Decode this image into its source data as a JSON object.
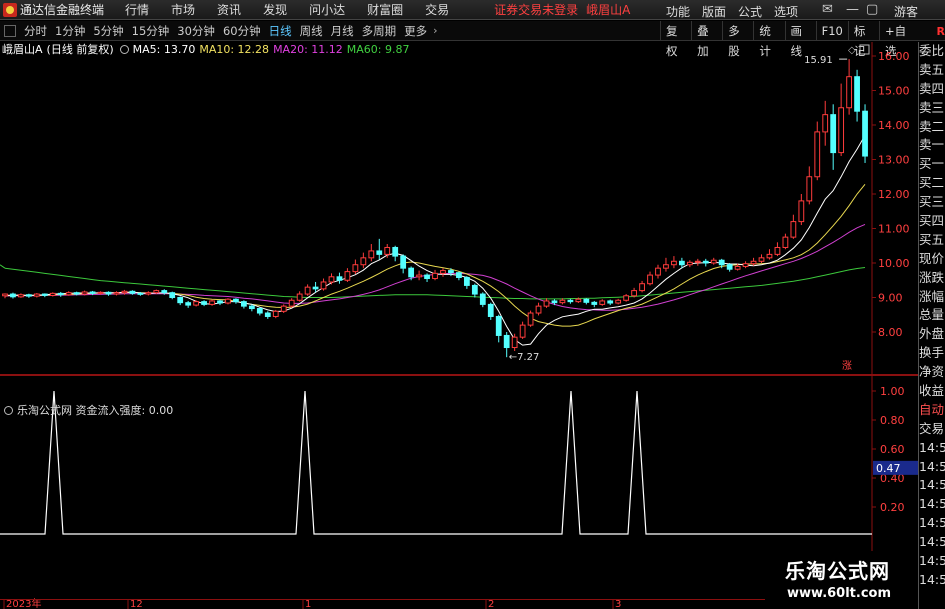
{
  "menubar": {
    "title": "通达信金融终端",
    "items": [
      "行情",
      "市场",
      "资讯",
      "发现",
      "问小达",
      "财富圈",
      "交易"
    ],
    "warning": "证券交易未登录",
    "stock": "峨眉山A",
    "right_items": [
      "功能",
      "版面",
      "公式",
      "选项"
    ],
    "guest": "游客"
  },
  "toolbar": {
    "periods": [
      "分时",
      "1分钟",
      "5分钟",
      "15分钟",
      "30分钟",
      "60分钟",
      "日线",
      "周线",
      "月线",
      "多周期",
      "更多"
    ],
    "active_period": "日线",
    "right_buttons": [
      "复权",
      "叠加",
      "多股",
      "统计",
      "画线",
      "F10",
      "标记",
      "+自选"
    ],
    "r_label": "R"
  },
  "chart_header": {
    "name": "峨眉山A",
    "mode": "(日线 前复权)",
    "ma5": "MA5: 13.70",
    "ma10": "MA10: 12.28",
    "ma20": "MA20: 11.12",
    "ma60": "MA60: 9.87"
  },
  "sub_header": {
    "text": "乐淘公式网 资金流入强度: 0.00"
  },
  "right_panel": {
    "items": [
      "委比",
      "卖五",
      "卖四",
      "卖三",
      "卖二",
      "卖一",
      "买一",
      "买二",
      "买三",
      "买四",
      "买五",
      "现价",
      "涨跌",
      "涨幅",
      "总量",
      "外盘",
      "换手",
      "净资",
      "收益",
      "自动",
      "交易",
      "14:56",
      "14:56",
      "14:56",
      "14:56",
      "14:56",
      "14:56",
      "14:56",
      "14:56"
    ]
  },
  "watermark": {
    "title": "乐淘公式网",
    "url": "www.60lt.com"
  },
  "chart_data": [
    {
      "type": "candlestick",
      "title": "峨眉山A",
      "yaxis_ticks": [
        16.0,
        15.0,
        14.0,
        13.0,
        12.0,
        11.0,
        10.0,
        9.0,
        8.0
      ],
      "ylim": [
        7.0,
        16.6
      ],
      "annotations": [
        {
          "label": "15.91",
          "value": 15.91
        },
        {
          "label": "7.27",
          "value": 7.27
        },
        {
          "label": "涨",
          "value": null
        }
      ],
      "xaxis_labels": [
        "2023年",
        "12",
        "1",
        "2",
        "3"
      ],
      "candles": [
        [
          9.05,
          9.1,
          8.98,
          9.12
        ],
        [
          9.1,
          9.02,
          8.97,
          9.14
        ],
        [
          9.02,
          9.08,
          8.99,
          9.12
        ],
        [
          9.08,
          9.04,
          8.99,
          9.11
        ],
        [
          9.04,
          9.1,
          9.0,
          9.13
        ],
        [
          9.1,
          9.06,
          9.01,
          9.12
        ],
        [
          9.06,
          9.12,
          9.03,
          9.15
        ],
        [
          9.12,
          9.08,
          9.02,
          9.16
        ],
        [
          9.08,
          9.14,
          9.05,
          9.18
        ],
        [
          9.14,
          9.1,
          9.06,
          9.17
        ],
        [
          9.1,
          9.16,
          9.06,
          9.2
        ],
        [
          9.16,
          9.12,
          9.07,
          9.19
        ],
        [
          9.12,
          9.15,
          9.08,
          9.18
        ],
        [
          9.15,
          9.1,
          9.05,
          9.18
        ],
        [
          9.1,
          9.14,
          9.06,
          9.18
        ],
        [
          9.14,
          9.18,
          9.08,
          9.22
        ],
        [
          9.18,
          9.12,
          9.08,
          9.21
        ],
        [
          9.12,
          9.1,
          9.05,
          9.16
        ],
        [
          9.1,
          9.14,
          9.06,
          9.18
        ],
        [
          9.14,
          9.2,
          9.1,
          9.23
        ],
        [
          9.2,
          9.14,
          9.08,
          9.24
        ],
        [
          9.14,
          9.0,
          8.95,
          9.17
        ],
        [
          9.0,
          8.85,
          8.78,
          9.03
        ],
        [
          8.85,
          8.78,
          8.7,
          8.9
        ],
        [
          8.78,
          8.88,
          8.74,
          8.92
        ],
        [
          8.88,
          8.8,
          8.75,
          8.92
        ],
        [
          8.8,
          8.9,
          8.76,
          8.94
        ],
        [
          8.9,
          8.84,
          8.78,
          8.93
        ],
        [
          8.84,
          8.95,
          8.8,
          8.98
        ],
        [
          8.95,
          8.88,
          8.82,
          8.98
        ],
        [
          8.88,
          8.75,
          8.68,
          8.92
        ],
        [
          8.75,
          8.68,
          8.6,
          8.8
        ],
        [
          8.68,
          8.55,
          8.48,
          8.72
        ],
        [
          8.55,
          8.45,
          8.38,
          8.6
        ],
        [
          8.45,
          8.6,
          8.4,
          8.64
        ],
        [
          8.6,
          8.75,
          8.55,
          8.8
        ],
        [
          8.75,
          8.92,
          8.7,
          8.98
        ],
        [
          8.92,
          9.1,
          8.88,
          9.18
        ],
        [
          9.1,
          9.3,
          9.05,
          9.38
        ],
        [
          9.3,
          9.25,
          9.15,
          9.45
        ],
        [
          9.25,
          9.45,
          9.2,
          9.55
        ],
        [
          9.45,
          9.6,
          9.38,
          9.7
        ],
        [
          9.6,
          9.5,
          9.4,
          9.72
        ],
        [
          9.5,
          9.75,
          9.45,
          9.85
        ],
        [
          9.75,
          9.95,
          9.68,
          10.1
        ],
        [
          9.95,
          10.15,
          9.85,
          10.3
        ],
        [
          10.15,
          10.35,
          10.05,
          10.55
        ],
        [
          10.35,
          10.25,
          10.1,
          10.7
        ],
        [
          10.25,
          10.45,
          10.15,
          10.55
        ],
        [
          10.45,
          10.2,
          10.05,
          10.5
        ],
        [
          10.2,
          9.85,
          9.7,
          10.25
        ],
        [
          9.85,
          9.6,
          9.5,
          9.9
        ],
        [
          9.6,
          9.65,
          9.5,
          9.78
        ],
        [
          9.65,
          9.55,
          9.45,
          9.7
        ],
        [
          9.55,
          9.7,
          9.5,
          9.8
        ],
        [
          9.7,
          9.78,
          9.6,
          9.85
        ],
        [
          9.78,
          9.72,
          9.62,
          9.85
        ],
        [
          9.72,
          9.58,
          9.5,
          9.75
        ],
        [
          9.58,
          9.35,
          9.25,
          9.62
        ],
        [
          9.35,
          9.1,
          9.0,
          9.4
        ],
        [
          9.1,
          8.8,
          8.72,
          9.15
        ],
        [
          8.8,
          8.45,
          8.35,
          8.85
        ],
        [
          8.45,
          7.9,
          7.7,
          8.5
        ],
        [
          7.9,
          7.55,
          7.27,
          8.0
        ],
        [
          7.55,
          7.85,
          7.45,
          7.95
        ],
        [
          7.85,
          8.2,
          7.8,
          8.3
        ],
        [
          8.2,
          8.55,
          8.15,
          8.62
        ],
        [
          8.55,
          8.75,
          8.48,
          8.85
        ],
        [
          8.75,
          8.9,
          8.7,
          8.98
        ],
        [
          8.9,
          8.85,
          8.78,
          8.95
        ],
        [
          8.85,
          8.92,
          8.8,
          8.98
        ],
        [
          8.92,
          8.88,
          8.82,
          8.96
        ],
        [
          8.88,
          8.95,
          8.84,
          9.0
        ],
        [
          8.95,
          8.86,
          8.8,
          8.98
        ],
        [
          8.86,
          8.8,
          8.72,
          8.9
        ],
        [
          8.8,
          8.9,
          8.76,
          8.95
        ],
        [
          8.9,
          8.84,
          8.78,
          8.94
        ],
        [
          8.84,
          8.92,
          8.8,
          8.96
        ],
        [
          8.92,
          9.05,
          8.88,
          9.1
        ],
        [
          9.05,
          9.2,
          9.0,
          9.28
        ],
        [
          9.2,
          9.4,
          9.15,
          9.48
        ],
        [
          9.4,
          9.65,
          9.35,
          9.75
        ],
        [
          9.65,
          9.85,
          9.55,
          9.95
        ],
        [
          9.85,
          9.95,
          9.75,
          10.15
        ],
        [
          9.95,
          10.05,
          9.85,
          10.2
        ],
        [
          10.05,
          9.95,
          9.85,
          10.15
        ],
        [
          9.95,
          10.02,
          9.88,
          10.08
        ],
        [
          10.02,
          10.05,
          9.92,
          10.12
        ],
        [
          10.05,
          10.0,
          9.9,
          10.12
        ],
        [
          10.0,
          10.08,
          9.95,
          10.15
        ],
        [
          10.08,
          9.95,
          9.85,
          10.12
        ],
        [
          9.95,
          9.82,
          9.75,
          10.0
        ],
        [
          9.82,
          9.9,
          9.78,
          9.98
        ],
        [
          9.9,
          9.98,
          9.85,
          10.05
        ],
        [
          9.98,
          10.05,
          9.92,
          10.15
        ],
        [
          10.05,
          10.15,
          10.0,
          10.25
        ],
        [
          10.15,
          10.25,
          10.1,
          10.4
        ],
        [
          10.25,
          10.45,
          10.2,
          10.6
        ],
        [
          10.45,
          10.75,
          10.4,
          10.85
        ],
        [
          10.75,
          11.2,
          10.7,
          11.4
        ],
        [
          11.2,
          11.8,
          11.1,
          12.0
        ],
        [
          11.8,
          12.5,
          11.7,
          12.8
        ],
        [
          12.5,
          13.8,
          12.4,
          14.1
        ],
        [
          13.8,
          14.3,
          13.4,
          14.7
        ],
        [
          14.3,
          13.2,
          12.7,
          14.6
        ],
        [
          13.2,
          14.5,
          13.1,
          15.2
        ],
        [
          14.5,
          15.4,
          14.3,
          15.91
        ],
        [
          15.4,
          14.4,
          14.1,
          15.6
        ],
        [
          14.4,
          13.1,
          12.9,
          14.6
        ]
      ],
      "ma5": [
        9.06,
        9.07,
        9.07,
        9.06,
        9.07,
        9.08,
        9.1,
        9.11,
        9.12,
        9.13,
        9.13,
        9.13,
        9.14,
        9.14,
        9.14,
        9.15,
        9.16,
        9.13,
        9.12,
        9.13,
        9.14,
        9.11,
        9.06,
        8.99,
        8.89,
        8.82,
        8.81,
        8.84,
        8.88,
        8.88,
        8.84,
        8.8,
        8.72,
        8.64,
        8.59,
        8.61,
        8.69,
        8.82,
        8.99,
        9.15,
        9.29,
        9.43,
        9.5,
        9.57,
        9.66,
        9.79,
        9.98,
        10.09,
        10.23,
        10.28,
        10.22,
        10.07,
        9.91,
        9.78,
        9.68,
        9.67,
        9.67,
        9.64,
        9.58,
        9.47,
        9.27,
        8.98,
        8.6,
        8.16,
        7.78,
        7.62,
        7.65,
        7.95,
        8.2,
        8.34,
        8.44,
        8.48,
        8.52,
        8.6,
        8.66,
        8.66,
        8.7,
        8.73,
        8.78,
        8.84,
        8.96,
        9.13,
        9.33,
        9.53,
        9.7,
        9.86,
        9.98,
        10.0,
        10.01,
        10.02,
        10.0,
        9.97,
        9.97,
        9.94,
        9.92,
        9.95,
        10.0,
        10.08,
        10.24,
        10.43,
        10.67,
        11.03,
        11.45,
        11.85,
        12.1,
        12.5,
        12.94,
        13.3,
        13.7
      ],
      "ma10": [
        9.05,
        9.06,
        9.06,
        9.06,
        9.06,
        9.07,
        9.08,
        9.09,
        9.09,
        9.1,
        9.11,
        9.12,
        9.13,
        9.13,
        9.14,
        9.14,
        9.15,
        9.14,
        9.13,
        9.13,
        9.13,
        9.12,
        9.1,
        9.06,
        9.01,
        8.97,
        8.95,
        8.94,
        8.93,
        8.89,
        8.84,
        8.8,
        8.77,
        8.74,
        8.72,
        8.71,
        8.72,
        8.75,
        8.81,
        8.9,
        9.0,
        9.1,
        9.18,
        9.27,
        9.37,
        9.47,
        9.58,
        9.7,
        9.82,
        9.92,
        10.0,
        10.03,
        10.0,
        9.95,
        9.9,
        9.86,
        9.82,
        9.76,
        9.68,
        9.58,
        9.47,
        9.33,
        9.17,
        8.97,
        8.75,
        8.56,
        8.4,
        8.3,
        8.25,
        8.2,
        8.17,
        8.17,
        8.2,
        8.28,
        8.38,
        8.46,
        8.54,
        8.62,
        8.69,
        8.74,
        8.81,
        8.91,
        9.02,
        9.13,
        9.25,
        9.39,
        9.53,
        9.65,
        9.75,
        9.84,
        9.9,
        9.93,
        9.95,
        9.97,
        9.97,
        9.98,
        9.99,
        10.04,
        10.09,
        10.15,
        10.24,
        10.38,
        10.58,
        10.82,
        11.08,
        11.35,
        11.66,
        12.0,
        12.28
      ],
      "ma20": [
        9.04,
        9.05,
        9.05,
        9.05,
        9.05,
        9.06,
        9.06,
        9.07,
        9.07,
        9.08,
        9.08,
        9.09,
        9.09,
        9.1,
        9.1,
        9.11,
        9.11,
        9.11,
        9.11,
        9.11,
        9.11,
        9.11,
        9.1,
        9.09,
        9.08,
        9.06,
        9.05,
        9.04,
        9.03,
        9.01,
        8.98,
        8.96,
        8.93,
        8.9,
        8.87,
        8.84,
        8.83,
        8.83,
        8.84,
        8.87,
        8.9,
        8.93,
        8.96,
        9.0,
        9.04,
        9.09,
        9.15,
        9.22,
        9.31,
        9.4,
        9.48,
        9.56,
        9.61,
        9.64,
        9.67,
        9.69,
        9.7,
        9.7,
        9.69,
        9.67,
        9.64,
        9.58,
        9.49,
        9.39,
        9.27,
        9.16,
        9.05,
        8.95,
        8.87,
        8.8,
        8.74,
        8.7,
        8.67,
        8.65,
        8.64,
        8.63,
        8.63,
        8.64,
        8.66,
        8.69,
        8.72,
        8.76,
        8.81,
        8.87,
        8.93,
        9.0,
        9.08,
        9.16,
        9.23,
        9.31,
        9.39,
        9.47,
        9.55,
        9.63,
        9.7,
        9.77,
        9.84,
        9.91,
        9.98,
        10.05,
        10.13,
        10.23,
        10.34,
        10.47,
        10.6,
        10.74,
        10.89,
        11.02,
        11.12
      ],
      "ma60": [
        9.85,
        9.82,
        9.79,
        9.76,
        9.73,
        9.7,
        9.67,
        9.64,
        9.61,
        9.58,
        9.55,
        9.52,
        9.49,
        9.47,
        9.45,
        9.43,
        9.41,
        9.39,
        9.37,
        9.35,
        9.33,
        9.31,
        9.29,
        9.27,
        9.25,
        9.23,
        9.21,
        9.19,
        9.17,
        9.15,
        9.13,
        9.11,
        9.09,
        9.07,
        9.05,
        9.03,
        9.02,
        9.01,
        9.0,
        9.0,
        9.0,
        9.0,
        9.01,
        9.02,
        9.03,
        9.04,
        9.05,
        9.06,
        9.07,
        9.08,
        9.08,
        9.08,
        9.08,
        9.08,
        9.07,
        9.06,
        9.05,
        9.04,
        9.03,
        9.02,
        9.01,
        9.0,
        8.99,
        8.98,
        8.97,
        8.97,
        8.96,
        8.96,
        8.96,
        8.96,
        8.96,
        8.97,
        8.97,
        8.98,
        8.98,
        8.99,
        9.0,
        9.01,
        9.02,
        9.03,
        9.05,
        9.07,
        9.09,
        9.11,
        9.13,
        9.15,
        9.17,
        9.19,
        9.21,
        9.23,
        9.25,
        9.27,
        9.29,
        9.31,
        9.33,
        9.35,
        9.38,
        9.41,
        9.44,
        9.47,
        9.51,
        9.55,
        9.6,
        9.65,
        9.7,
        9.75,
        9.8,
        9.84,
        9.87
      ]
    },
    {
      "type": "line",
      "title": "资金流入强度",
      "yaxis_ticks": [
        1.0,
        0.8,
        0.6,
        0.4,
        0.2
      ],
      "ylim": [
        0,
        1.1
      ],
      "current_value_label": "0.47",
      "spikes": [
        {
          "x_index": 9,
          "value": 1.0
        },
        {
          "x_index": 56,
          "value": 1.0
        },
        {
          "x_index": 105,
          "value": 1.0
        },
        {
          "x_index": 117,
          "value": 1.0
        }
      ],
      "x_count": 170
    }
  ]
}
